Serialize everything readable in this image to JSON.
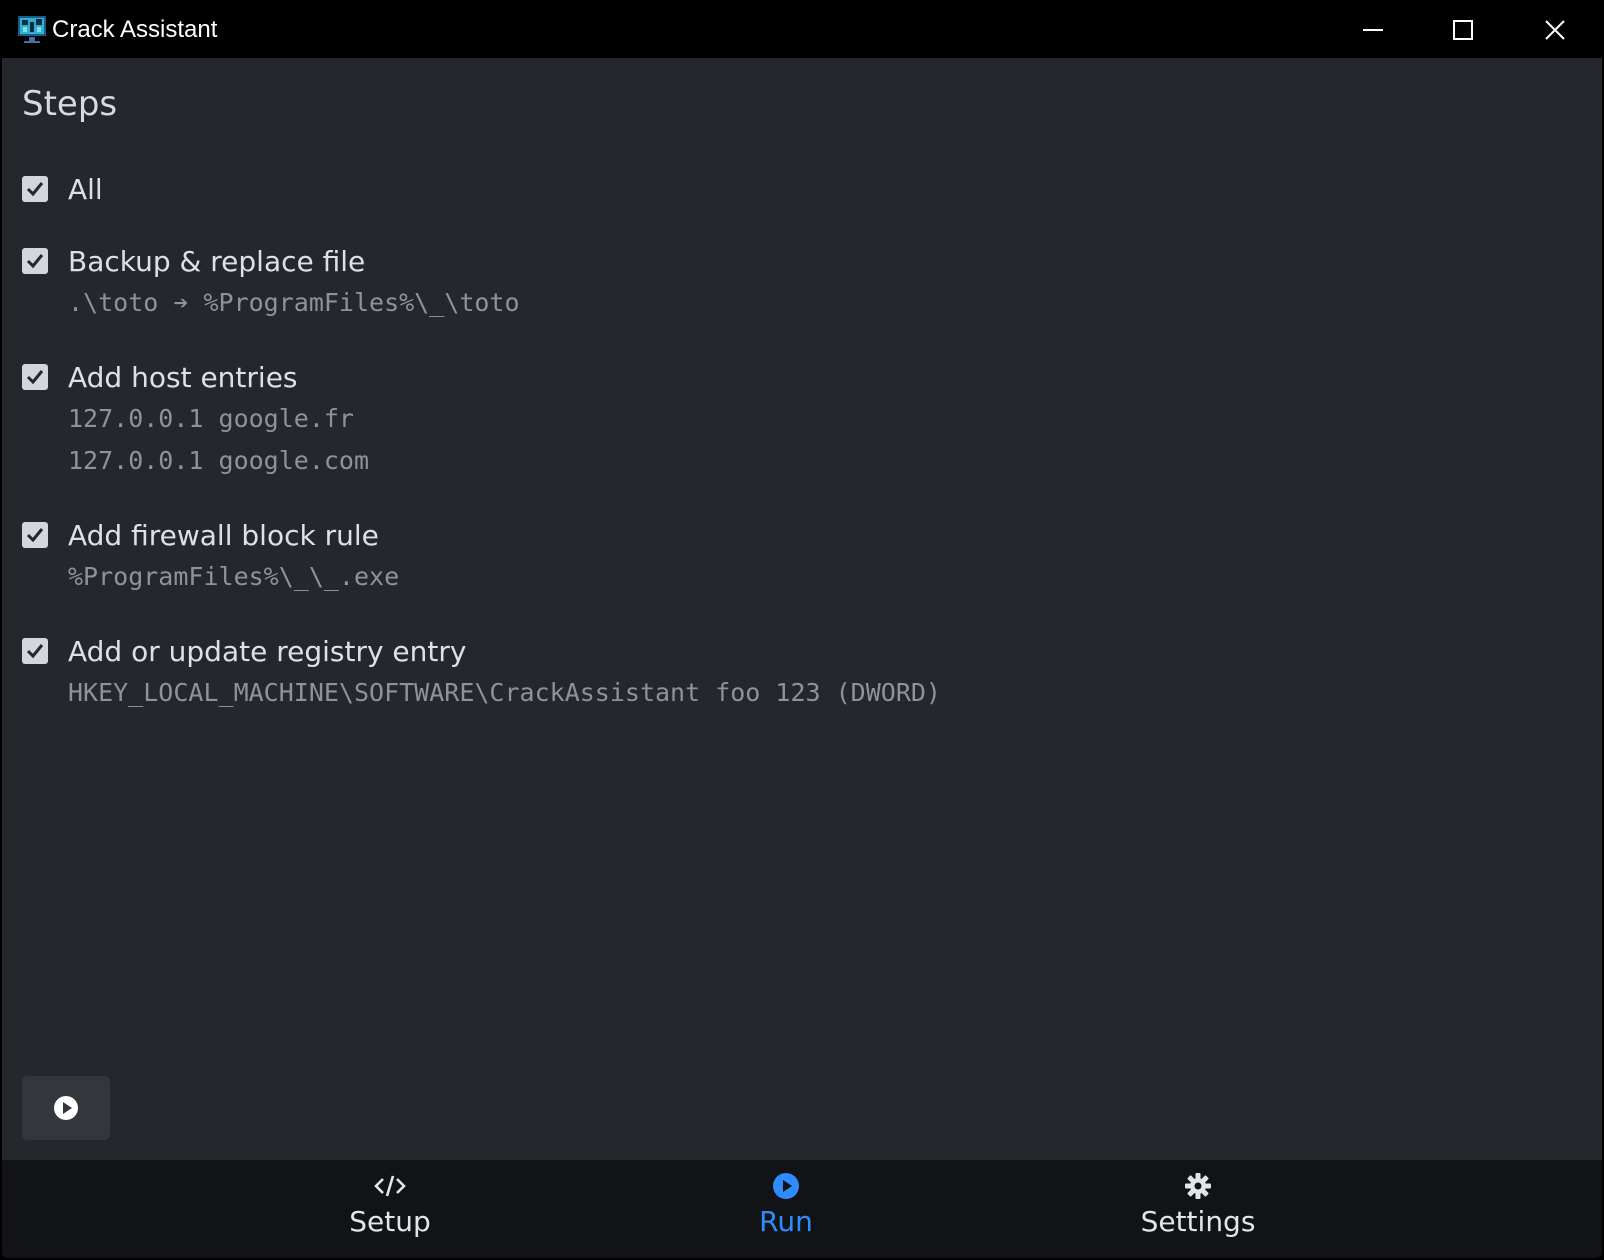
{
  "window": {
    "title": "Crack Assistant",
    "icon": "app-logo-icon"
  },
  "colors": {
    "background": "#24272c",
    "titlebar": "#000000",
    "nav_background": "#111316",
    "accent": "#2f8cff",
    "text": "#dde0e4",
    "muted": "#8f9399"
  },
  "steps": {
    "title": "Steps",
    "items": [
      {
        "label": "All",
        "checked": true,
        "details": []
      },
      {
        "label": "Backup & replace file",
        "checked": true,
        "details": [
          ".\\toto ➔ %ProgramFiles%\\_\\toto"
        ]
      },
      {
        "label": "Add host entries",
        "checked": true,
        "details": [
          "127.0.0.1 google.fr",
          "127.0.0.1 google.com"
        ]
      },
      {
        "label": "Add firewall block rule",
        "checked": true,
        "details": [
          "%ProgramFiles%\\_\\_.exe"
        ]
      },
      {
        "label": "Add or update registry entry",
        "checked": true,
        "details": [
          "HKEY_LOCAL_MACHINE\\SOFTWARE\\CrackAssistant foo 123 (DWORD)"
        ]
      }
    ]
  },
  "run_button": {
    "icon": "play-circle-icon"
  },
  "nav": {
    "items": [
      {
        "label": "Setup",
        "icon": "code-icon",
        "active": false
      },
      {
        "label": "Run",
        "icon": "play-circle-icon",
        "active": true
      },
      {
        "label": "Settings",
        "icon": "gear-icon",
        "active": false
      }
    ]
  }
}
